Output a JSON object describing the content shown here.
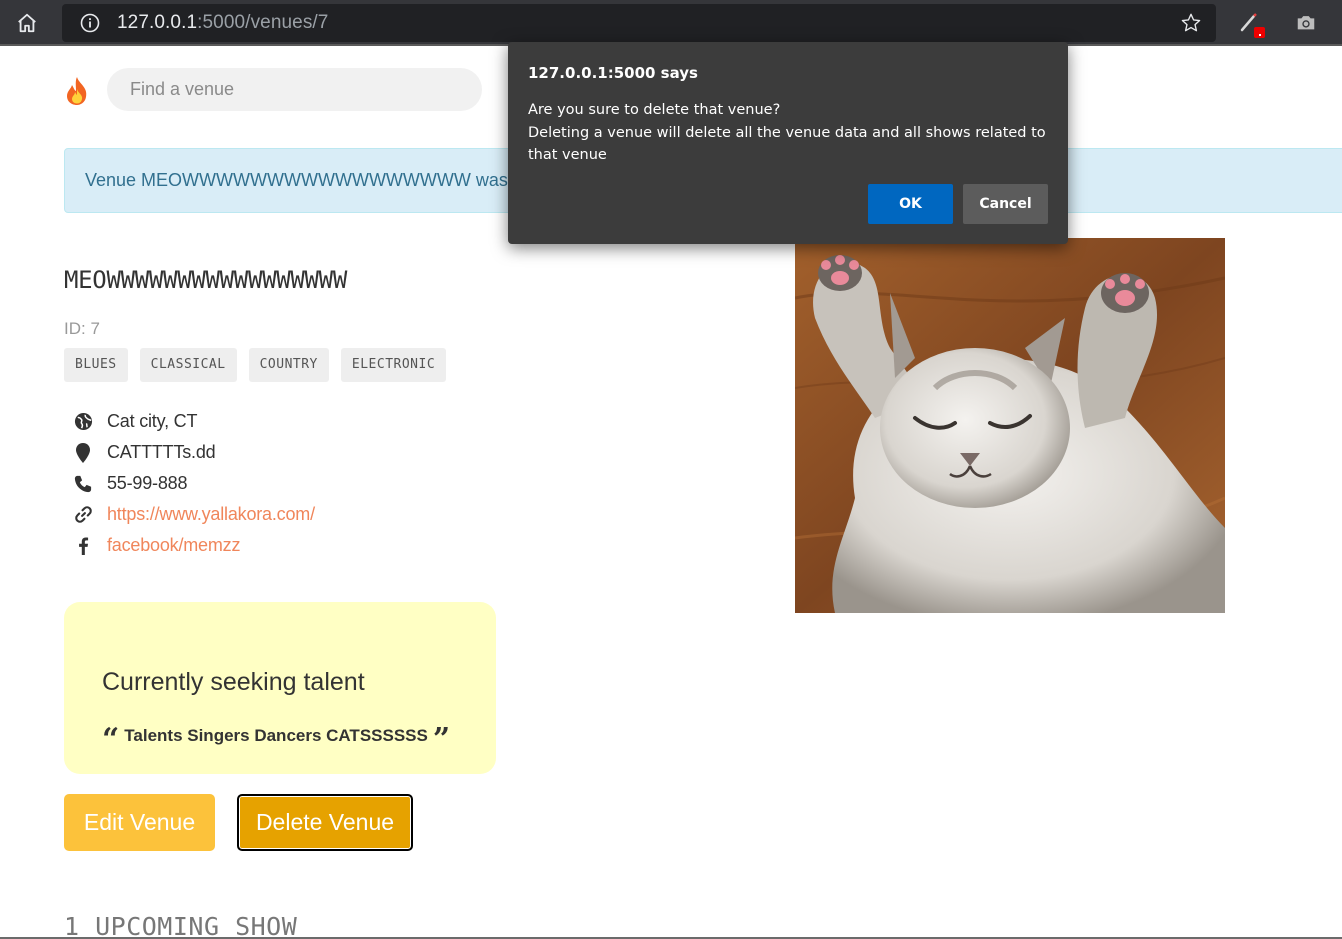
{
  "browser": {
    "url_host": "127.0.0.1",
    "url_path": ":5000/venues/7"
  },
  "search": {
    "placeholder": "Find a venue"
  },
  "flash_message": "Venue MEOWWWWWWWWWWWWWWWWW was successfully listed!",
  "venue": {
    "name": "MEOWWWWWWWWWWWWWWWWW",
    "id_label": "ID: 7",
    "genres": [
      "BLUES",
      "CLASSICAL",
      "COUNTRY",
      "ELECTRONIC"
    ],
    "location": "Cat city, CT",
    "address": "CATTTTTs.dd",
    "phone": "55-99-888",
    "website": "https://www.yallakora.com/",
    "facebook": "facebook/memzz"
  },
  "seeking": {
    "title": "Currently seeking talent",
    "description": "Talents Singers Dancers CATSSSSSS"
  },
  "actions": {
    "edit_label": "Edit Venue",
    "delete_label": "Delete Venue"
  },
  "upcoming_heading": "1 UPCOMING SHOW",
  "dialog": {
    "title": "127.0.0.1:5000 says",
    "line1": "Are you sure to delete that venue?",
    "line2": "Deleting a venue will delete all the venue data and all shows related to that venue",
    "ok_label": "OK",
    "cancel_label": "Cancel"
  },
  "colors": {
    "accent_link": "#f0865b",
    "edit_button": "#fcc23b",
    "delete_button": "#e6a200",
    "seeking_bg": "#ffffc4",
    "dialog_ok": "#0067c0"
  }
}
